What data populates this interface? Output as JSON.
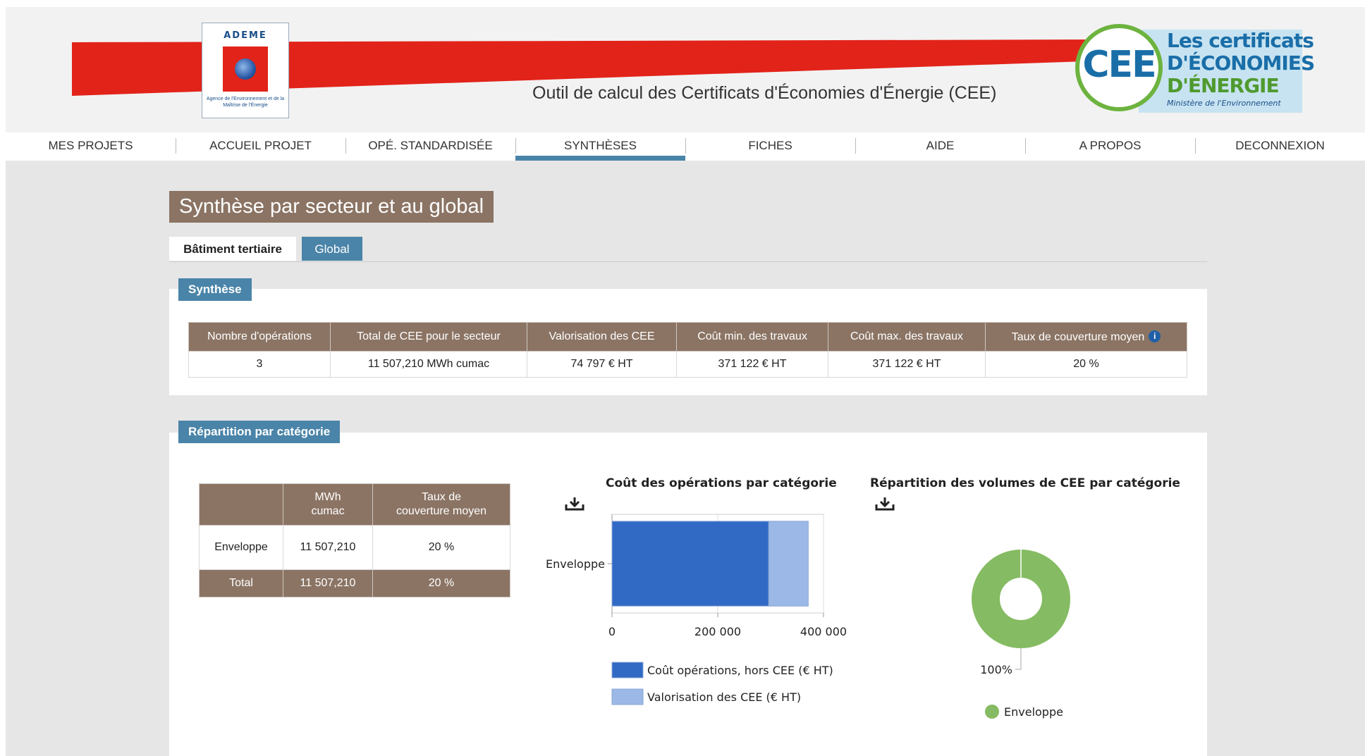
{
  "header": {
    "ademe_logo_text": "ADEME",
    "ademe_logo_subtitle": "Agence de l'Environnement et de la Maîtrise de l'Énergie",
    "app_title": "Outil de calcul des Certificats d'Économies d'Énergie (CEE)",
    "cee_logo": {
      "badge": "CEE",
      "line1": "Les certificats",
      "line2": "D'ÉCONOMIES",
      "line3": "D'ÉNERGIE",
      "line4": "Ministère de l'Environnement"
    }
  },
  "nav": {
    "items": [
      "MES PROJETS",
      "ACCUEIL PROJET",
      "OPÉ. STANDARDISÉE",
      "SYNTHÈSES",
      "FICHES",
      "AIDE",
      "A PROPOS",
      "DECONNEXION"
    ],
    "active": "SYNTHÈSES"
  },
  "page": {
    "title": "Synthèse par secteur et au global",
    "tabs": [
      "Bâtiment tertiaire",
      "Global"
    ],
    "active_tab": "Bâtiment tertiaire"
  },
  "synthese": {
    "label": "Synthèse",
    "headers": [
      "Nombre d'opérations",
      "Total de CEE pour le secteur",
      "Valorisation des CEE",
      "Coût min. des travaux",
      "Coût max. des travaux",
      "Taux de couverture moyen"
    ],
    "row": [
      "3",
      "11 507,210 MWh cumac",
      "74 797 € HT",
      "371 122 € HT",
      "371 122 € HT",
      "20 %"
    ],
    "info_icon": "i"
  },
  "repartition": {
    "label": "Répartition par catégorie",
    "table": {
      "headers": [
        "",
        "MWh\ncumac",
        "Taux de\ncouverture moyen"
      ],
      "rows": [
        [
          "Enveloppe",
          "11 507,210",
          "20 %"
        ]
      ],
      "total": [
        "Total",
        "11 507,210",
        "20 %"
      ]
    }
  },
  "colors": {
    "accent": "#4a84a8",
    "table_header": "#8b7464",
    "cost_bar": "#316ac5",
    "cee_bar": "#9bb8e6",
    "pie": "#85bb62",
    "brand_red": "#e2231a"
  },
  "chart_data": [
    {
      "type": "bar",
      "orientation": "horizontal",
      "stacked": true,
      "title": "Coût des opérations par catégorie",
      "categories": [
        "Enveloppe"
      ],
      "series": [
        {
          "name": "Coût opérations, hors CEE (€ HT)",
          "values": [
            296325
          ],
          "color": "#316ac5"
        },
        {
          "name": "Valorisation des CEE (€ HT)",
          "values": [
            74797
          ],
          "color": "#9bb8e6"
        }
      ],
      "x_ticks": [
        "0",
        "200 000",
        "400 000"
      ],
      "xlim": [
        0,
        400000
      ],
      "grid": true,
      "legend": "bottom",
      "download_icon": "download-icon"
    },
    {
      "type": "pie",
      "donut": true,
      "title": "Répartition des volumes de CEE par catégorie",
      "labels": [
        "Enveloppe"
      ],
      "values": [
        100
      ],
      "data_labels": [
        "100%"
      ],
      "colors": [
        "#85bb62"
      ],
      "legend": "bottom",
      "download_icon": "download-icon"
    }
  ]
}
